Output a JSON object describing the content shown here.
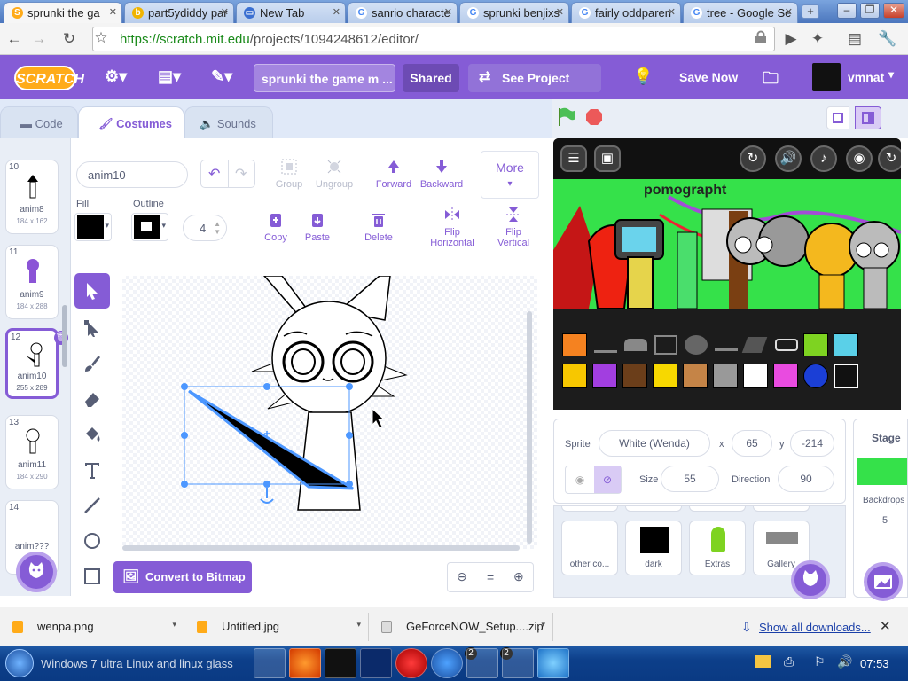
{
  "browser": {
    "tabs": [
      {
        "title": "sprunki the ga",
        "favicon": "scratch",
        "active": true
      },
      {
        "title": "part5ydiddy par",
        "favicon": "page",
        "active": false
      },
      {
        "title": "New Tab",
        "favicon": "newtab",
        "active": false
      },
      {
        "title": "sanrio characte",
        "favicon": "google",
        "active": false
      },
      {
        "title": "sprunki benjixs",
        "favicon": "google",
        "active": false
      },
      {
        "title": "fairly oddparen",
        "favicon": "google",
        "active": false
      },
      {
        "title": "tree - Google Se",
        "favicon": "google",
        "active": false
      }
    ],
    "url_host": "https://scratch.mit.edu",
    "url_path": "/projects/1094248612/editor/"
  },
  "menubar": {
    "logo": "SCRATCH",
    "project_name": "sprunki the game m ...",
    "shared_label": "Shared",
    "see_project_label": "See Project Page",
    "save_now_label": "Save Now",
    "username": "vmnat"
  },
  "editor_tabs": {
    "code": "Code",
    "costumes": "Costumes",
    "sounds": "Sounds"
  },
  "costumes": [
    {
      "num": "10",
      "name": "anim8",
      "size": "184 x 162"
    },
    {
      "num": "11",
      "name": "anim9",
      "size": "184 x 288"
    },
    {
      "num": "12",
      "name": "anim10",
      "size": "255 x 289",
      "selected": true
    },
    {
      "num": "13",
      "name": "anim11",
      "size": "184 x 290"
    },
    {
      "num": "14",
      "name": "anim???",
      "size": ""
    }
  ],
  "paint": {
    "costume_name": "anim10",
    "fill_label": "Fill",
    "outline_label": "Outline",
    "outline_width": "4",
    "group_label": "Group",
    "ungroup_label": "Ungroup",
    "forward_label": "Forward",
    "backward_label": "Backward",
    "more_label": "More",
    "copy_label": "Copy",
    "paste_label": "Paste",
    "delete_label": "Delete",
    "flip_h_label": "Flip Horizontal",
    "flip_v_label": "Flip Vertical",
    "convert_label": "Convert to Bitmap",
    "zoom_reset": "="
  },
  "stage": {
    "title_text": "pomographt"
  },
  "sprite_info": {
    "sprite_label": "Sprite",
    "sprite_name": "White (Wenda)",
    "x_label": "x",
    "x_value": "65",
    "y_label": "y",
    "y_value": "-214",
    "size_label": "Size",
    "size_value": "55",
    "direction_label": "Direction",
    "direction_value": "90"
  },
  "sprites": [
    {
      "name": "other co..."
    },
    {
      "name": "dark"
    },
    {
      "name": "Extras"
    },
    {
      "name": "Gallery"
    }
  ],
  "stage_panel": {
    "title": "Stage",
    "backdrops_label": "Backdrops",
    "backdrops_count": "5"
  },
  "downloads": {
    "items": [
      "wenpa.png",
      "Untitled.jpg",
      "GeForceNOW_Setup....zip"
    ],
    "show_all": "Show all downloads..."
  },
  "taskbar": {
    "text": "Windows 7 ultra Linux and linux glass",
    "clock": "07:53",
    "badges": [
      "2",
      "2"
    ]
  },
  "colors": {
    "scratch_purple": "#855cd6",
    "scratch_orange": "#ffab19",
    "stage_green": "#35e14a"
  }
}
